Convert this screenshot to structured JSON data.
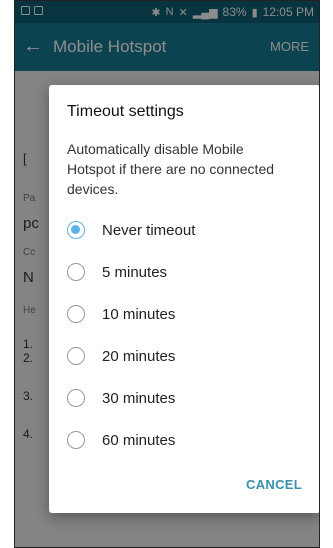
{
  "status_bar": {
    "battery": "83%",
    "time": "12:05 PM"
  },
  "app_bar": {
    "title": "Mobile Hotspot",
    "more": "MORE"
  },
  "dialog": {
    "title": "Timeout settings",
    "description": "Automatically disable Mobile Hotspot if there are no connected devices.",
    "options": [
      {
        "label": "Never timeout",
        "selected": true
      },
      {
        "label": "5 minutes",
        "selected": false
      },
      {
        "label": "10 minutes",
        "selected": false
      },
      {
        "label": "20 minutes",
        "selected": false
      },
      {
        "label": "30 minutes",
        "selected": false
      },
      {
        "label": "60 minutes",
        "selected": false
      }
    ],
    "cancel": "CANCEL"
  },
  "accent_color": "#5fb0e6"
}
